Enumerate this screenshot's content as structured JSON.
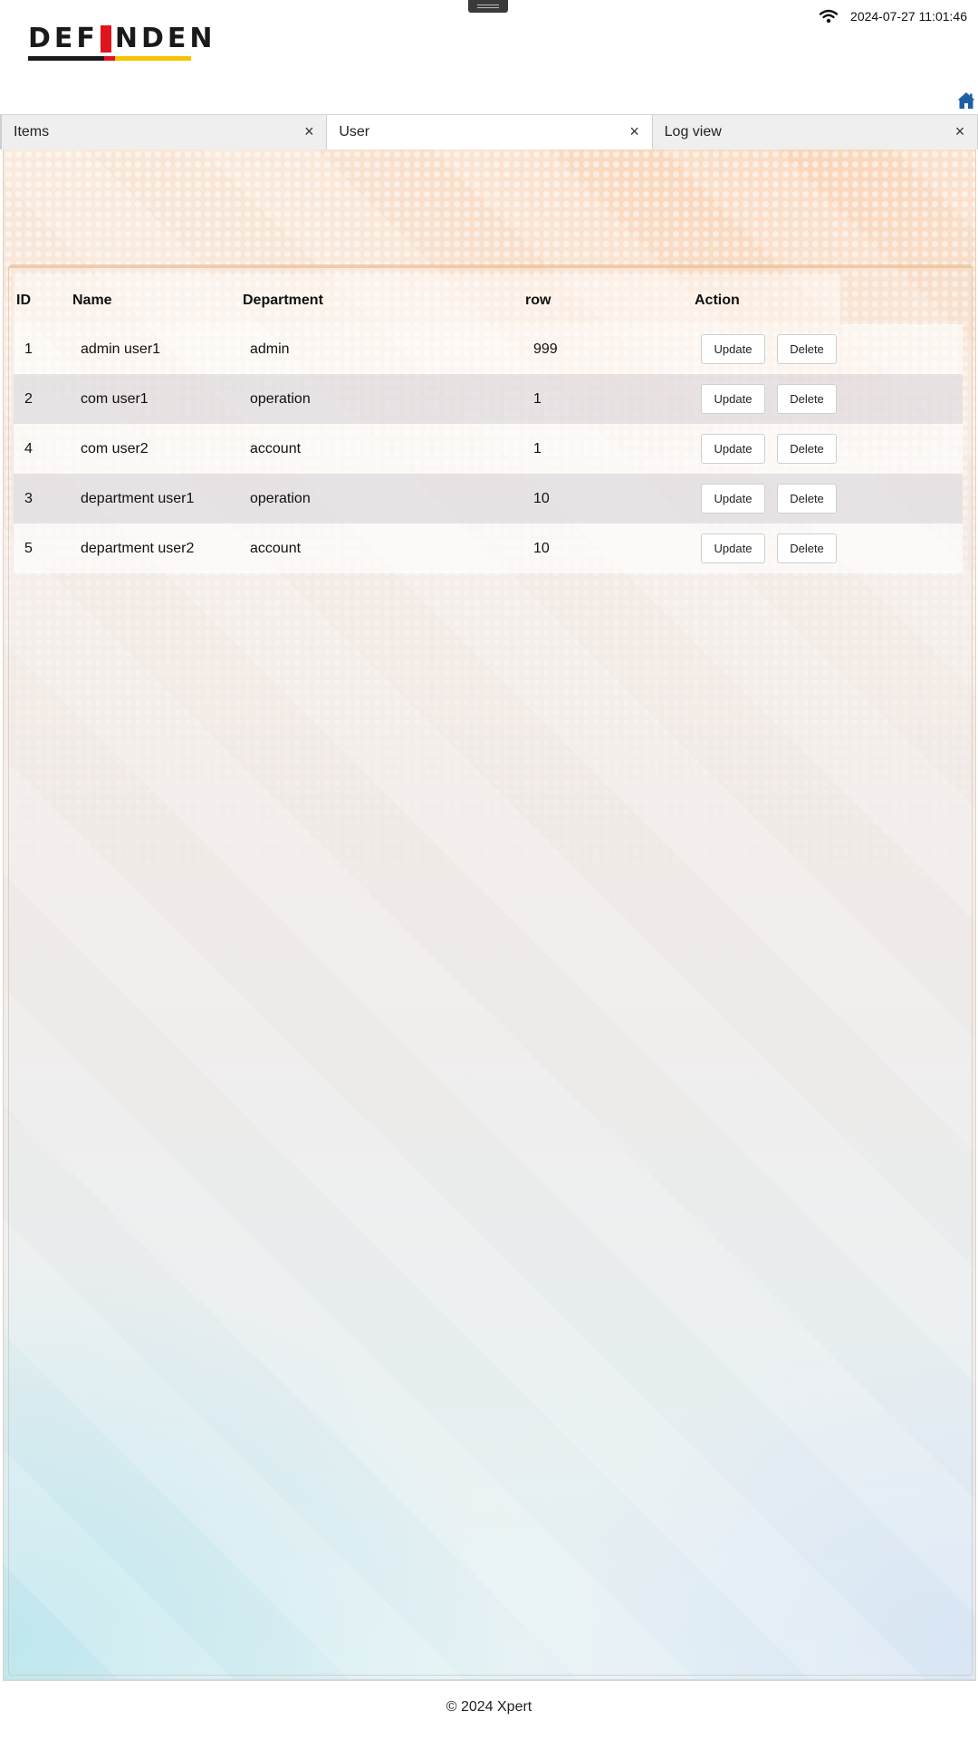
{
  "header": {
    "logo_text_left": "DEF",
    "logo_text_right": "NDEN",
    "datetime": "2024-07-27 11:01:46"
  },
  "tabs": [
    {
      "label": "Items",
      "close": "×",
      "active": false
    },
    {
      "label": "User",
      "close": "×",
      "active": true
    },
    {
      "label": "Log view",
      "close": "×",
      "active": false
    }
  ],
  "table": {
    "columns": [
      "ID",
      "Name",
      "Department",
      "row",
      "Action"
    ],
    "rows": [
      {
        "id": "1",
        "name": "admin user1",
        "department": "admin",
        "row": "999",
        "update": "Update",
        "delete": "Delete"
      },
      {
        "id": "2",
        "name": "com user1",
        "department": "operation",
        "row": "1",
        "update": "Update",
        "delete": "Delete"
      },
      {
        "id": "4",
        "name": "com user2",
        "department": "account",
        "row": "1",
        "update": "Update",
        "delete": "Delete"
      },
      {
        "id": "3",
        "name": "department user1",
        "department": "operation",
        "row": "10",
        "update": "Update",
        "delete": "Delete"
      },
      {
        "id": "5",
        "name": "department user2",
        "department": "account",
        "row": "10",
        "update": "Update",
        "delete": "Delete"
      }
    ]
  },
  "footer": {
    "copyright": "© 2024 Xpert"
  },
  "icons": {
    "wifi": "wifi-icon",
    "home": "home-icon",
    "close": "close-icon"
  },
  "colors": {
    "home_icon": "#1f5fa8",
    "logo_red": "#e0141e",
    "logo_yellow": "#f5c400"
  }
}
